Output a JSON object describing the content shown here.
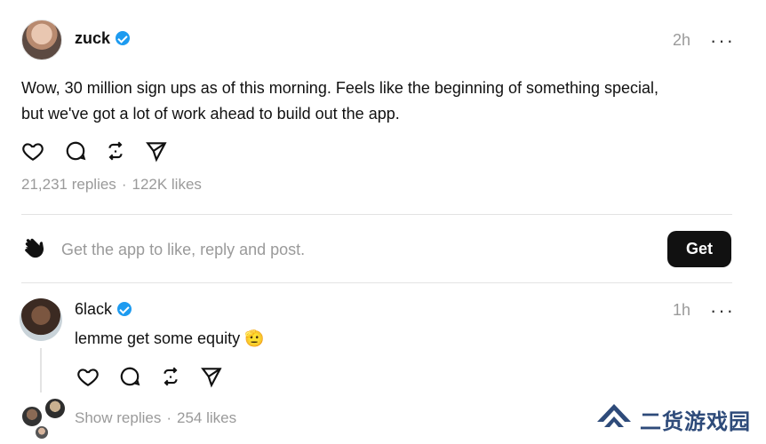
{
  "post": {
    "author": "zuck",
    "time": "2h",
    "more": "···",
    "text_line1": "Wow, 30 million sign ups as of this morning. Feels like the beginning of something special,",
    "text_line2": "but we've got a lot of work ahead to build out the app.",
    "replies": "21,231 replies",
    "likes": "122K likes",
    "sep": "·"
  },
  "cta": {
    "icon": "waving-hand-icon",
    "text": "Get the app to like, reply and post.",
    "button": "Get"
  },
  "reply": {
    "author": "6lack",
    "time": "1h",
    "more": "···",
    "text": "lemme get some equity 🫡",
    "show_replies": "Show replies",
    "likes": "254 likes",
    "sep": "·"
  },
  "watermark": {
    "text": "二货游戏园"
  },
  "colors": {
    "verified": "#1d9bf0",
    "muted": "#9a9a9a",
    "button_bg": "#111111",
    "watermark": "#2e4b7a"
  },
  "icons": [
    "heart-icon",
    "comment-icon",
    "repost-icon",
    "share-icon",
    "more-icon",
    "verified-badge-icon"
  ]
}
